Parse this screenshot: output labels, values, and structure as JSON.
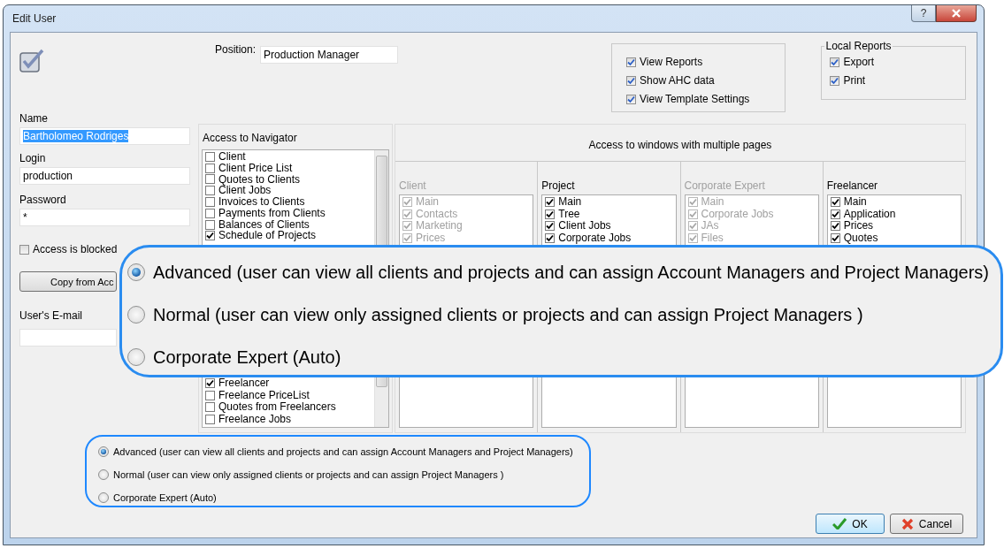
{
  "window": {
    "title": "Edit User",
    "help_glyph": "?"
  },
  "position": {
    "label": "Position:",
    "value": "Production Manager"
  },
  "reports": [
    {
      "label": "View Reports",
      "checked": true
    },
    {
      "label": "Show AHC data",
      "checked": true
    },
    {
      "label": "View Template Settings",
      "checked": true
    }
  ],
  "local_reports": {
    "title": "Local Reports",
    "items": [
      {
        "label": "Export",
        "checked": true
      },
      {
        "label": "Print",
        "checked": true
      }
    ]
  },
  "user": {
    "name_label": "Name",
    "name": "Bartholomeo Rodriges",
    "name_text_selected": true,
    "login_label": "Login",
    "login": "production",
    "password_label": "Password",
    "password": "*",
    "access_blocked": {
      "label": "Access is blocked",
      "checked": false
    },
    "copy_button": "Copy from Acc",
    "email_label": "User's E-mail"
  },
  "navigator": {
    "title": "Access to Navigator",
    "items_top": [
      {
        "label": "Client",
        "checked": false
      },
      {
        "label": "Client Price List",
        "checked": false
      },
      {
        "label": "Quotes to Clients",
        "checked": false
      },
      {
        "label": "Client Jobs",
        "checked": false
      },
      {
        "label": "Invoices to Clients",
        "checked": false
      },
      {
        "label": "Payments from Clients",
        "checked": false
      },
      {
        "label": "Balances of Clients",
        "checked": false
      },
      {
        "label": "Schedule of Projects",
        "checked": true
      }
    ],
    "items_bottom": [
      {
        "label": "Freelancer",
        "checked": true
      },
      {
        "label": "Freelance PriceList",
        "checked": false
      },
      {
        "label": "Quotes from Freelancers",
        "checked": false
      },
      {
        "label": "Freelance Jobs",
        "checked": false
      }
    ]
  },
  "multi_pages": {
    "title": "Access to windows with multiple pages",
    "columns": [
      {
        "title": "Client",
        "disabled": true,
        "items": [
          {
            "label": "Main",
            "checked": true
          },
          {
            "label": "Contacts",
            "checked": true
          },
          {
            "label": "Marketing",
            "checked": true
          },
          {
            "label": "Prices",
            "checked": true
          }
        ]
      },
      {
        "title": "Project",
        "disabled": false,
        "items": [
          {
            "label": "Main",
            "checked": true
          },
          {
            "label": "Tree",
            "checked": true
          },
          {
            "label": "Client Jobs",
            "checked": true
          },
          {
            "label": "Corporate Jobs",
            "checked": true
          }
        ]
      },
      {
        "title": "Corporate Expert",
        "disabled": true,
        "items": [
          {
            "label": "Main",
            "checked": true
          },
          {
            "label": "Corporate Jobs",
            "checked": true
          },
          {
            "label": "JAs",
            "checked": true
          },
          {
            "label": "Files",
            "checked": true
          }
        ]
      },
      {
        "title": "Freelancer",
        "disabled": false,
        "items": [
          {
            "label": "Main",
            "checked": true
          },
          {
            "label": "Application",
            "checked": true
          },
          {
            "label": "Prices",
            "checked": true
          },
          {
            "label": "Quotes",
            "checked": true
          }
        ]
      }
    ]
  },
  "access_level": {
    "options": [
      {
        "label": "Advanced (user can view all clients and projects and can assign Account Managers and Project Managers)",
        "selected": true
      },
      {
        "label": "Normal (user can view only assigned clients or projects and can assign Project Managers )",
        "selected": false
      },
      {
        "label": "Corporate Expert (Auto)",
        "selected": false
      }
    ]
  },
  "zoom_callout": {
    "options": [
      {
        "label": "Advanced (user can view all clients and projects and can assign Account Managers and Project Managers)",
        "selected": true
      },
      {
        "label": "Normal (user can view only assigned clients or projects and can assign Project Managers )",
        "selected": false
      },
      {
        "label": "Corporate Expert (Auto)",
        "selected": false
      }
    ]
  },
  "buttons": [
    {
      "label": "OK",
      "kind": "ok",
      "default": true
    },
    {
      "label": "Cancel",
      "kind": "cancel",
      "default": false
    }
  ]
}
